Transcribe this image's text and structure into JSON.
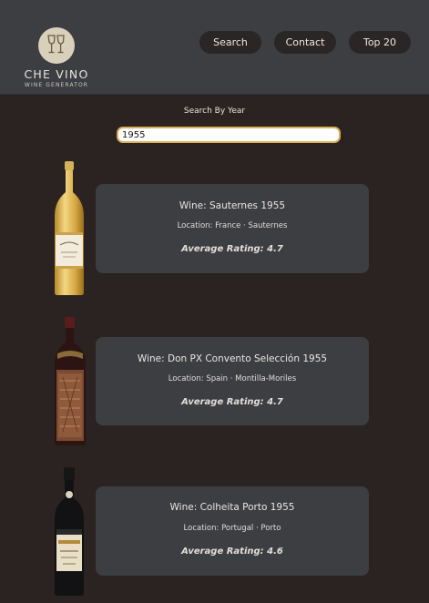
{
  "brand": {
    "name": "CHE VINO",
    "tagline": "WINE GENERATOR"
  },
  "nav": [
    {
      "label": "Search"
    },
    {
      "label": "Contact"
    },
    {
      "label": "Top 20"
    }
  ],
  "search": {
    "label": "Search By Year",
    "value": "1955"
  },
  "results": [
    {
      "wine": "Wine: Sauternes 1955",
      "location": "Location: France · Sauternes",
      "rating": "Average Rating: 4.7"
    },
    {
      "wine": "Wine: Don PX Convento Selección 1955",
      "location": "Location: Spain · Montilla-Moriles",
      "rating": "Average Rating: 4.7"
    },
    {
      "wine": "Wine: Colheita Porto 1955",
      "location": "Location: Portugal · Porto",
      "rating": "Average Rating: 4.6"
    }
  ],
  "colors": {
    "background": "#2a2321",
    "header": "#3c3e42",
    "card": "#3c3e42",
    "input_border": "#d8b05a"
  }
}
